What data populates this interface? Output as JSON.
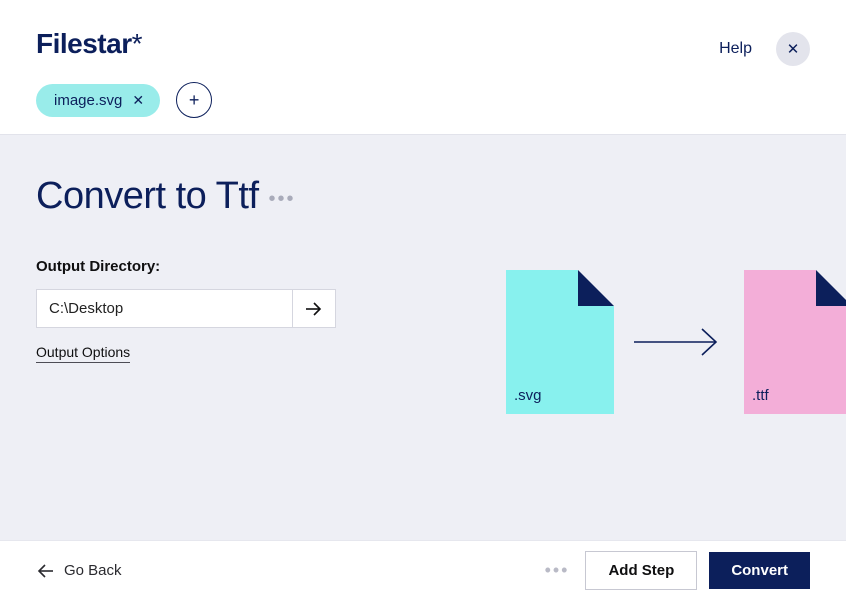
{
  "brand": {
    "name": "Filestar",
    "suffix": "*"
  },
  "header": {
    "file_chip_label": "image.svg",
    "help_label": "Help"
  },
  "main": {
    "title": "Convert to Ttf",
    "output_label": "Output Directory:",
    "output_path": "C:\\Desktop",
    "options_link": "Output Options"
  },
  "preview": {
    "from_ext": ".svg",
    "to_ext": ".ttf"
  },
  "footer": {
    "go_back": "Go Back",
    "add_step": "Add Step",
    "convert": "Convert"
  }
}
